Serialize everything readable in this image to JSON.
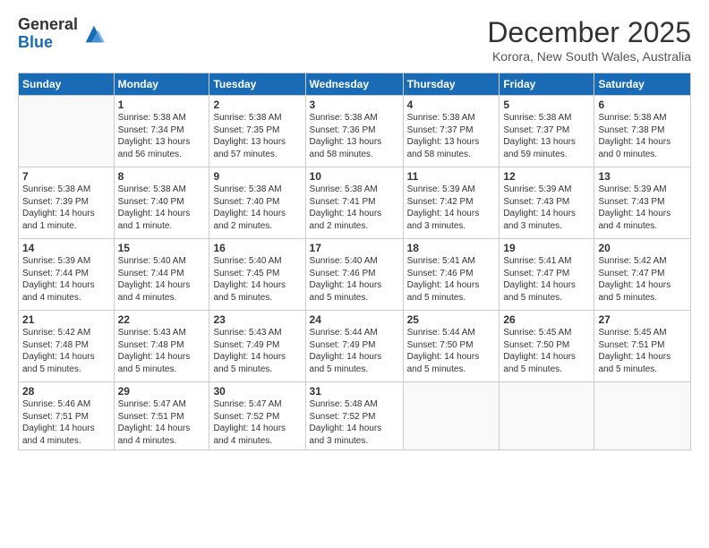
{
  "header": {
    "logo_line1": "General",
    "logo_line2": "Blue",
    "month": "December 2025",
    "location": "Korora, New South Wales, Australia"
  },
  "days_of_week": [
    "Sunday",
    "Monday",
    "Tuesday",
    "Wednesday",
    "Thursday",
    "Friday",
    "Saturday"
  ],
  "weeks": [
    [
      {
        "num": "",
        "info": ""
      },
      {
        "num": "1",
        "info": "Sunrise: 5:38 AM\nSunset: 7:34 PM\nDaylight: 13 hours\nand 56 minutes."
      },
      {
        "num": "2",
        "info": "Sunrise: 5:38 AM\nSunset: 7:35 PM\nDaylight: 13 hours\nand 57 minutes."
      },
      {
        "num": "3",
        "info": "Sunrise: 5:38 AM\nSunset: 7:36 PM\nDaylight: 13 hours\nand 58 minutes."
      },
      {
        "num": "4",
        "info": "Sunrise: 5:38 AM\nSunset: 7:37 PM\nDaylight: 13 hours\nand 58 minutes."
      },
      {
        "num": "5",
        "info": "Sunrise: 5:38 AM\nSunset: 7:37 PM\nDaylight: 13 hours\nand 59 minutes."
      },
      {
        "num": "6",
        "info": "Sunrise: 5:38 AM\nSunset: 7:38 PM\nDaylight: 14 hours\nand 0 minutes."
      }
    ],
    [
      {
        "num": "7",
        "info": "Sunrise: 5:38 AM\nSunset: 7:39 PM\nDaylight: 14 hours\nand 1 minute."
      },
      {
        "num": "8",
        "info": "Sunrise: 5:38 AM\nSunset: 7:40 PM\nDaylight: 14 hours\nand 1 minute."
      },
      {
        "num": "9",
        "info": "Sunrise: 5:38 AM\nSunset: 7:40 PM\nDaylight: 14 hours\nand 2 minutes."
      },
      {
        "num": "10",
        "info": "Sunrise: 5:38 AM\nSunset: 7:41 PM\nDaylight: 14 hours\nand 2 minutes."
      },
      {
        "num": "11",
        "info": "Sunrise: 5:39 AM\nSunset: 7:42 PM\nDaylight: 14 hours\nand 3 minutes."
      },
      {
        "num": "12",
        "info": "Sunrise: 5:39 AM\nSunset: 7:43 PM\nDaylight: 14 hours\nand 3 minutes."
      },
      {
        "num": "13",
        "info": "Sunrise: 5:39 AM\nSunset: 7:43 PM\nDaylight: 14 hours\nand 4 minutes."
      }
    ],
    [
      {
        "num": "14",
        "info": "Sunrise: 5:39 AM\nSunset: 7:44 PM\nDaylight: 14 hours\nand 4 minutes."
      },
      {
        "num": "15",
        "info": "Sunrise: 5:40 AM\nSunset: 7:44 PM\nDaylight: 14 hours\nand 4 minutes."
      },
      {
        "num": "16",
        "info": "Sunrise: 5:40 AM\nSunset: 7:45 PM\nDaylight: 14 hours\nand 5 minutes."
      },
      {
        "num": "17",
        "info": "Sunrise: 5:40 AM\nSunset: 7:46 PM\nDaylight: 14 hours\nand 5 minutes."
      },
      {
        "num": "18",
        "info": "Sunrise: 5:41 AM\nSunset: 7:46 PM\nDaylight: 14 hours\nand 5 minutes."
      },
      {
        "num": "19",
        "info": "Sunrise: 5:41 AM\nSunset: 7:47 PM\nDaylight: 14 hours\nand 5 minutes."
      },
      {
        "num": "20",
        "info": "Sunrise: 5:42 AM\nSunset: 7:47 PM\nDaylight: 14 hours\nand 5 minutes."
      }
    ],
    [
      {
        "num": "21",
        "info": "Sunrise: 5:42 AM\nSunset: 7:48 PM\nDaylight: 14 hours\nand 5 minutes."
      },
      {
        "num": "22",
        "info": "Sunrise: 5:43 AM\nSunset: 7:48 PM\nDaylight: 14 hours\nand 5 minutes."
      },
      {
        "num": "23",
        "info": "Sunrise: 5:43 AM\nSunset: 7:49 PM\nDaylight: 14 hours\nand 5 minutes."
      },
      {
        "num": "24",
        "info": "Sunrise: 5:44 AM\nSunset: 7:49 PM\nDaylight: 14 hours\nand 5 minutes."
      },
      {
        "num": "25",
        "info": "Sunrise: 5:44 AM\nSunset: 7:50 PM\nDaylight: 14 hours\nand 5 minutes."
      },
      {
        "num": "26",
        "info": "Sunrise: 5:45 AM\nSunset: 7:50 PM\nDaylight: 14 hours\nand 5 minutes."
      },
      {
        "num": "27",
        "info": "Sunrise: 5:45 AM\nSunset: 7:51 PM\nDaylight: 14 hours\nand 5 minutes."
      }
    ],
    [
      {
        "num": "28",
        "info": "Sunrise: 5:46 AM\nSunset: 7:51 PM\nDaylight: 14 hours\nand 4 minutes."
      },
      {
        "num": "29",
        "info": "Sunrise: 5:47 AM\nSunset: 7:51 PM\nDaylight: 14 hours\nand 4 minutes."
      },
      {
        "num": "30",
        "info": "Sunrise: 5:47 AM\nSunset: 7:52 PM\nDaylight: 14 hours\nand 4 minutes."
      },
      {
        "num": "31",
        "info": "Sunrise: 5:48 AM\nSunset: 7:52 PM\nDaylight: 14 hours\nand 3 minutes."
      },
      {
        "num": "",
        "info": ""
      },
      {
        "num": "",
        "info": ""
      },
      {
        "num": "",
        "info": ""
      }
    ]
  ]
}
